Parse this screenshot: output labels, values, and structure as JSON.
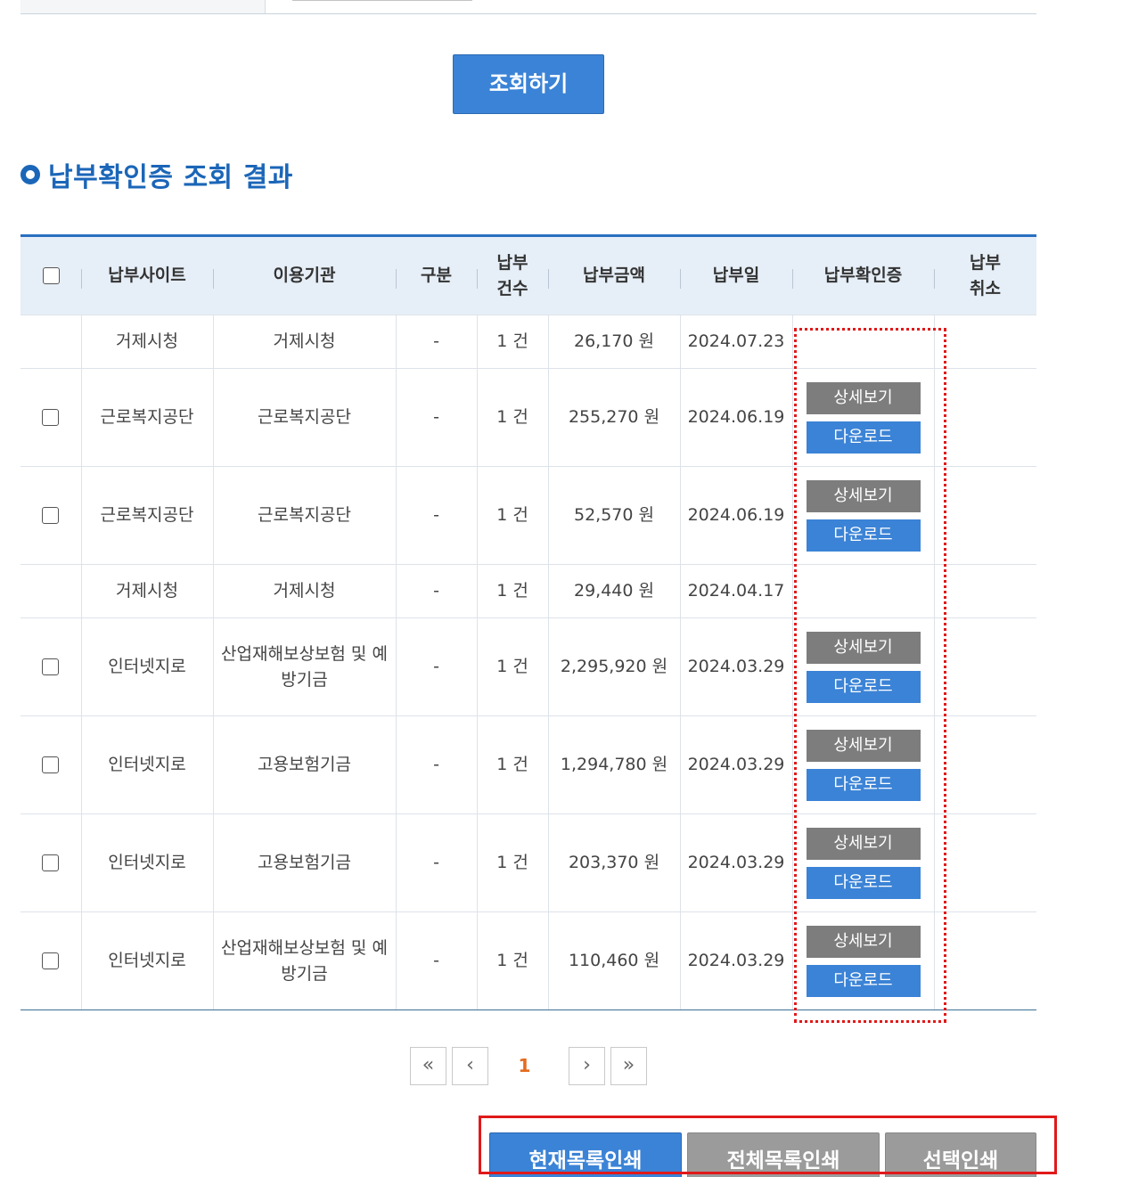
{
  "search": {
    "button_label": "조회하기"
  },
  "section": {
    "title": "납부확인증 조회 결과"
  },
  "table": {
    "headers": {
      "site": "납부사이트",
      "agency": "이용기관",
      "type": "구분",
      "count_line1": "납부",
      "count_line2": "건수",
      "amount": "납부금액",
      "date": "납부일",
      "cert": "납부확인증",
      "cancel_line1": "납부",
      "cancel_line2": "취소"
    },
    "rows": [
      {
        "site": "거제시청",
        "agency": "거제시청",
        "type": "-",
        "count": "1 건",
        "amount": "26,170 원",
        "date": "2024.07.23"
      },
      {
        "site": "근로복지공단",
        "agency": "근로복지공단",
        "type": "-",
        "count": "1 건",
        "amount": "255,270 원",
        "date": "2024.06.19"
      },
      {
        "site": "근로복지공단",
        "agency": "근로복지공단",
        "type": "-",
        "count": "1 건",
        "amount": "52,570 원",
        "date": "2024.06.19"
      },
      {
        "site": "거제시청",
        "agency": "거제시청",
        "type": "-",
        "count": "1 건",
        "amount": "29,440 원",
        "date": "2024.04.17"
      },
      {
        "site": "인터넷지로",
        "agency": "산업재해보상보험 및 예방기금",
        "type": "-",
        "count": "1 건",
        "amount": "2,295,920 원",
        "date": "2024.03.29"
      },
      {
        "site": "인터넷지로",
        "agency": "고용보험기금",
        "type": "-",
        "count": "1 건",
        "amount": "1,294,780 원",
        "date": "2024.03.29"
      },
      {
        "site": "인터넷지로",
        "agency": "고용보험기금",
        "type": "-",
        "count": "1 건",
        "amount": "203,370 원",
        "date": "2024.03.29"
      },
      {
        "site": "인터넷지로",
        "agency": "산업재해보상보험 및 예방기금",
        "type": "-",
        "count": "1 건",
        "amount": "110,460 원",
        "date": "2024.03.29"
      }
    ],
    "detail_label": "상세보기",
    "download_label": "다운로드"
  },
  "pagination": {
    "first": "«",
    "prev": "‹",
    "current": "1",
    "next": "›",
    "last": "»"
  },
  "actions": {
    "print_current": "현재목록인쇄",
    "print_all": "전체목록인쇄",
    "print_selected": "선택인쇄"
  },
  "colors": {
    "primary": "#3b83d6",
    "title": "#1b66b8",
    "highlight": "#e0191a",
    "page_current": "#e46b1f"
  }
}
